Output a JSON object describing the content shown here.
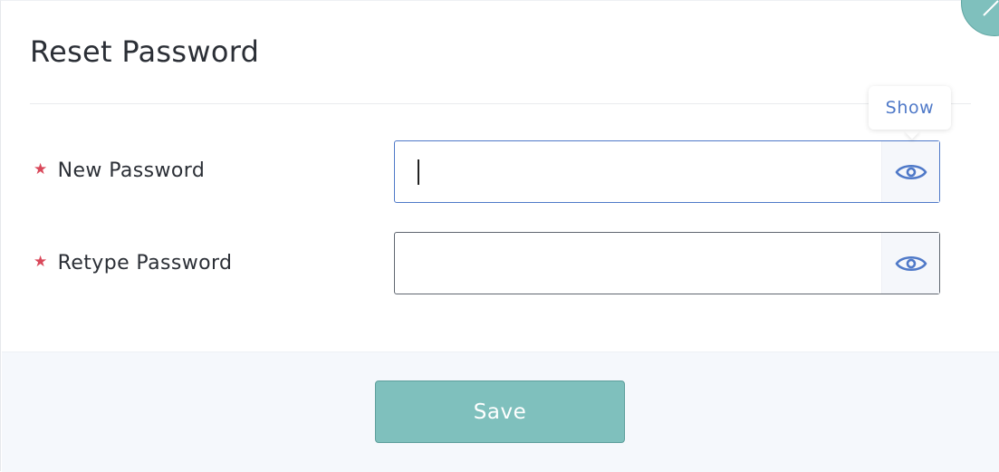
{
  "dialog": {
    "title": "Reset Password"
  },
  "fields": [
    {
      "label": "New Password",
      "value": "",
      "required": true,
      "focused": true,
      "toggle_icon": "eye-icon"
    },
    {
      "label": "Retype Password",
      "value": "",
      "required": true,
      "focused": false,
      "toggle_icon": "eye-icon"
    }
  ],
  "required_marker": "★",
  "tooltip": {
    "text": "Show"
  },
  "footer": {
    "save_label": "Save"
  },
  "colors": {
    "accent_teal": "#7fc0bd",
    "focus_blue": "#4f79c8",
    "required_red": "#d9485a",
    "text_dark": "#2b2f36",
    "footer_bg": "#f5f8fc"
  },
  "icons": {
    "close": "close-icon",
    "visibility": "eye-icon"
  }
}
